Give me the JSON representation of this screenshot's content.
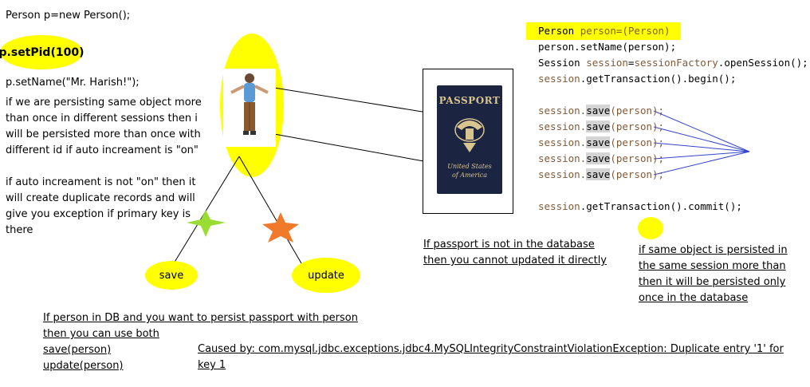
{
  "left": {
    "line1": "Person p=new Person();",
    "setPid": "p.setPid(100)",
    "setName": "p.setName(\"Mr. Harish!\");",
    "note1": [
      "if we are persisting same object more",
      "than once in different sessions then i",
      "will be persisted more than once with",
      "different id if auto increament is \"on\""
    ],
    "note2": [
      "if auto increament is not \"on\" then it",
      "will create duplicate records and will",
      "give you exception if primary key is",
      "there"
    ]
  },
  "ops": {
    "save": "save",
    "update": "update"
  },
  "bottom": {
    "person_db": [
      "If person in DB and you want to persist passport with person",
      "then you can use both ",
      "save(person)",
      "update(person)"
    ],
    "exception": [
      "Caused by: com.mysql.jdbc.exceptions.jdbc4.MySQLIntegrityConstraintViolationException: Duplicate entry '1' for",
      "key 1"
    ]
  },
  "passport": {
    "title": "PASSPORT",
    "sub1": "United States",
    "sub2": "of America",
    "note": [
      "If passport is not in the database",
      "then you cannot updated it directly "
    ]
  },
  "code": {
    "l1a": "Person ",
    "l1b": "person",
    "l1c": "=(Person)",
    "l2": "person.setName(person);",
    "l3a": "Session ",
    "l3b": "session",
    "l3c": "=",
    "l3d": "sessionFactory",
    "l3e": ".openSession();",
    "l4a": "session",
    "l4b": ".getTransaction().begin();",
    "save_lines": [
      {
        "a": "session.",
        "b": "save",
        "c": "(person);"
      },
      {
        "a": "session.",
        "b": "save",
        "c": "(person);"
      },
      {
        "a": "session.",
        "b": "save",
        "c": "(person);"
      },
      {
        "a": "session.",
        "b": "save",
        "c": "(person);"
      },
      {
        "a": "session.",
        "b": "save",
        "c": "(person);"
      }
    ],
    "commit_a": "session",
    "commit_b": ".getTransaction().commit();"
  },
  "right_note": [
    "if same object is persisted in",
    "the same session more than",
    "then it will be persisted only",
    "once in the database"
  ],
  "colors": {
    "highlight": "#ffff00",
    "star_green": "#99dd33",
    "star_orange": "#f07a2a",
    "arrow_blue": "#3344cc",
    "keyword": "#7f5a3a"
  }
}
